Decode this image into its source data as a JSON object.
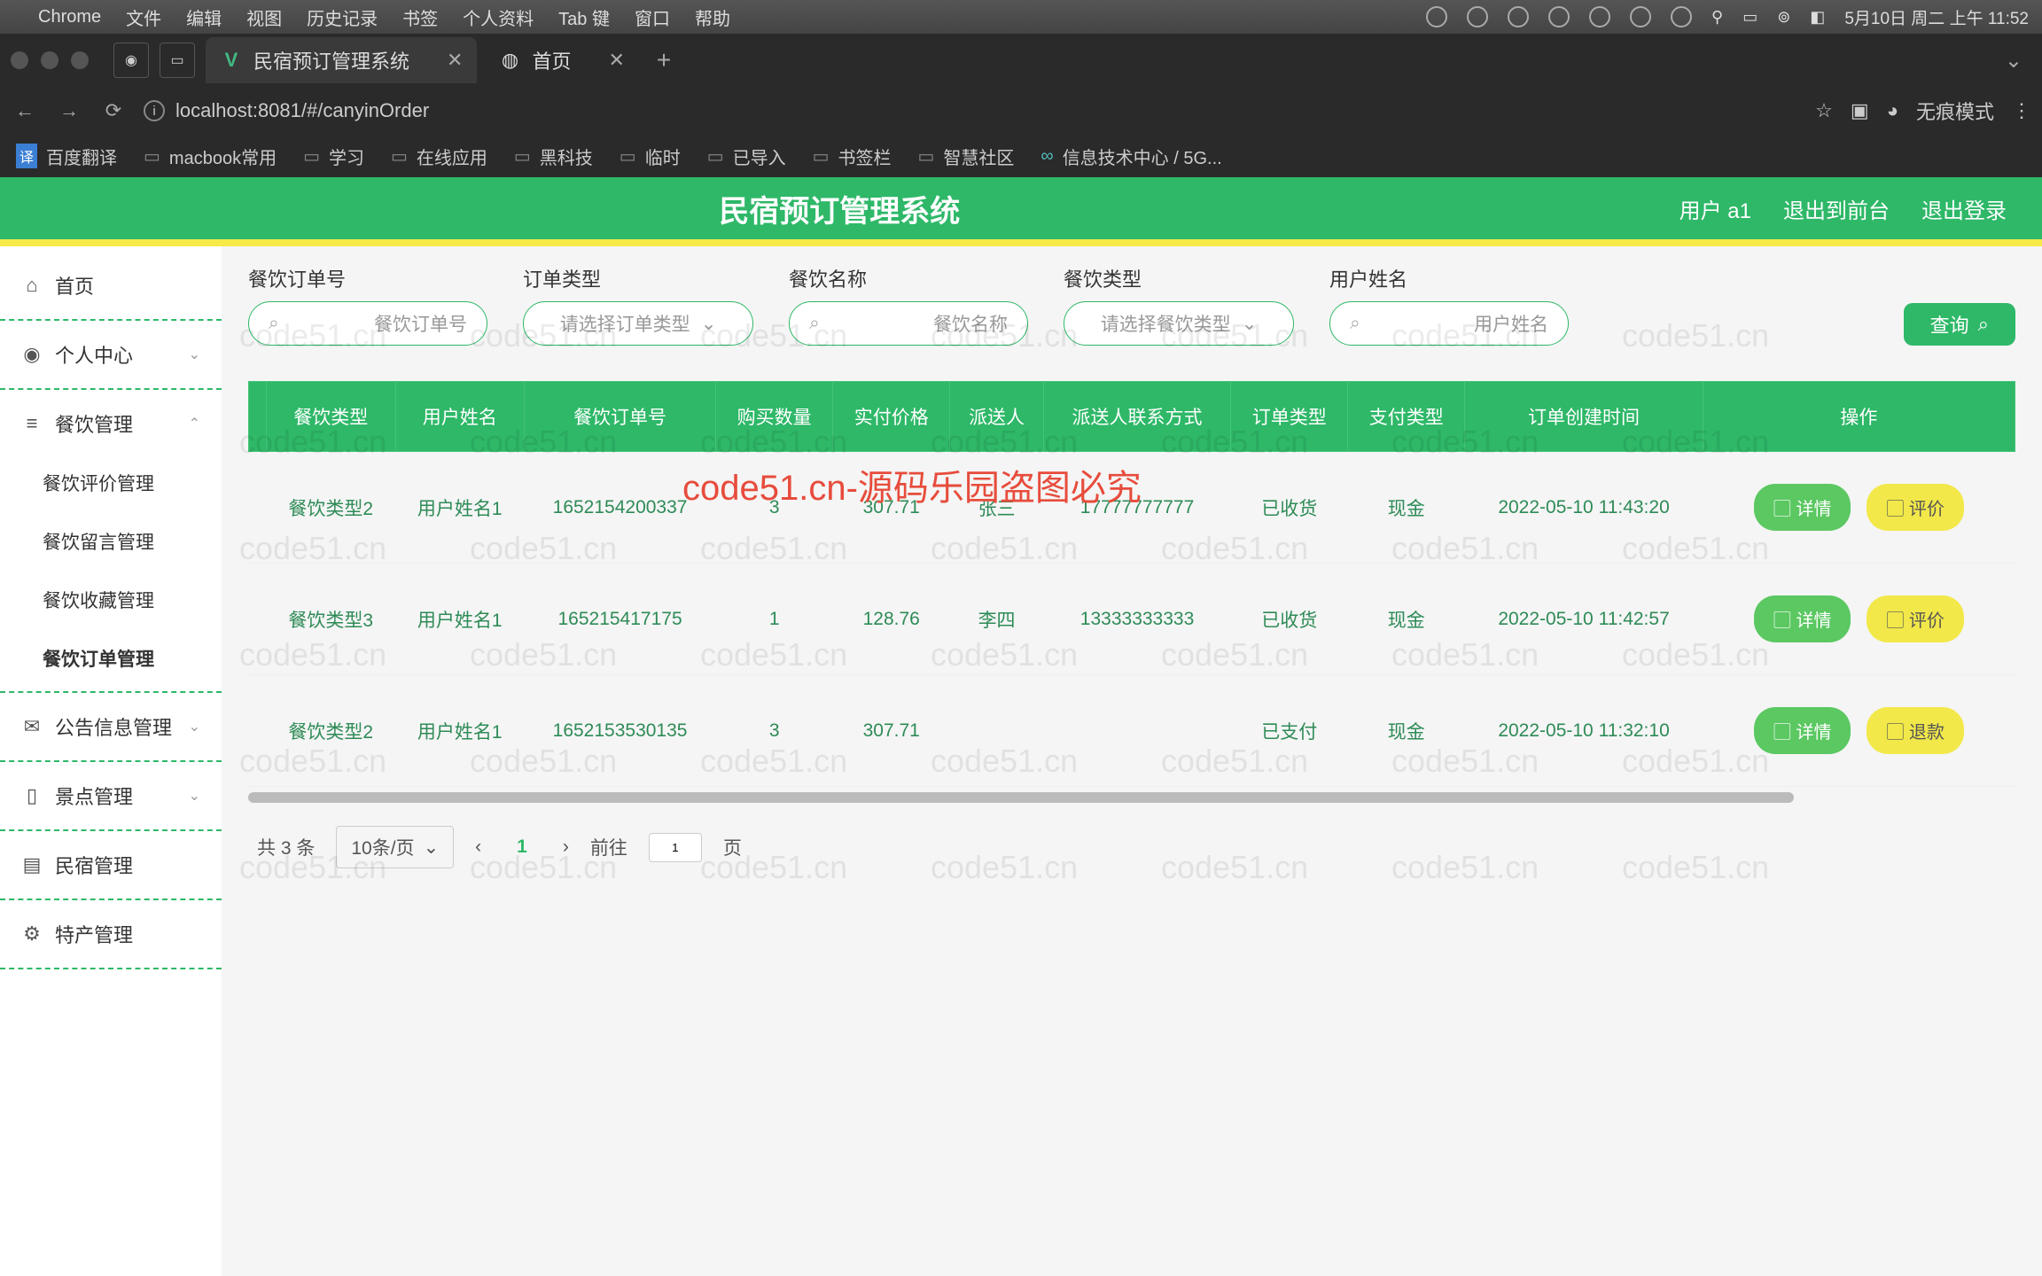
{
  "mac_menu": {
    "app": "Chrome",
    "items": [
      "文件",
      "编辑",
      "视图",
      "历史记录",
      "书签",
      "个人资料",
      "Tab 键",
      "窗口",
      "帮助"
    ],
    "clock": "5月10日 周二 上午 11:52"
  },
  "browser": {
    "tabs": [
      {
        "title": "民宿预订管理系统",
        "active": true
      },
      {
        "title": "首页",
        "active": false
      }
    ],
    "url": "localhost:8081/#/canyinOrder",
    "incognito": "无痕模式",
    "bookmarks": [
      "百度翻译",
      "macbook常用",
      "学习",
      "在线应用",
      "黑科技",
      "临时",
      "已导入",
      "书签栏",
      "智慧社区",
      "信息技术中心 / 5G..."
    ]
  },
  "app": {
    "title": "民宿预订管理系统",
    "user": "用户 a1",
    "to_front": "退出到前台",
    "logout": "退出登录"
  },
  "sidebar": {
    "home": "首页",
    "personal": "个人中心",
    "catering": "餐饮管理",
    "catering_children": [
      "餐饮评价管理",
      "餐饮留言管理",
      "餐饮收藏管理",
      "餐饮订单管理"
    ],
    "active_child": "餐饮订单管理",
    "announce": "公告信息管理",
    "spot": "景点管理",
    "homestay": "民宿管理",
    "specialty": "特产管理"
  },
  "filters": {
    "f1_label": "餐饮订单号",
    "f1_ph": "餐饮订单号",
    "f2_label": "订单类型",
    "f2_ph": "请选择订单类型",
    "f3_label": "餐饮名称",
    "f3_ph": "餐饮名称",
    "f4_label": "餐饮类型",
    "f4_ph": "请选择餐饮类型",
    "f5_label": "用户姓名",
    "f5_ph": "用户姓名",
    "query": "查询"
  },
  "table": {
    "headers": [
      "餐饮类型",
      "用户姓名",
      "餐饮订单号",
      "购买数量",
      "实付价格",
      "派送人",
      "派送人联系方式",
      "订单类型",
      "支付类型",
      "订单创建时间",
      "操作"
    ],
    "rows": [
      {
        "type": "餐饮类型2",
        "user": "用户姓名1",
        "order": "1652154200337",
        "qty": "3",
        "price": "307.71",
        "courier": "张三",
        "phone": "17777777777",
        "status": "已收货",
        "pay": "现金",
        "time": "2022-05-10 11:43:20",
        "ops": [
          "详情",
          "评价"
        ]
      },
      {
        "type": "餐饮类型3",
        "user": "用户姓名1",
        "order": "165215417175",
        "qty": "1",
        "price": "128.76",
        "courier": "李四",
        "phone": "13333333333",
        "status": "已收货",
        "pay": "现金",
        "time": "2022-05-10 11:42:57",
        "ops": [
          "详情",
          "评价"
        ]
      },
      {
        "type": "餐饮类型2",
        "user": "用户姓名1",
        "order": "1652153530135",
        "qty": "3",
        "price": "307.71",
        "courier": "",
        "phone": "",
        "status": "已支付",
        "pay": "现金",
        "time": "2022-05-10 11:32:10",
        "ops": [
          "详情",
          "退款"
        ]
      }
    ],
    "btn_detail": "详情"
  },
  "pager": {
    "total": "共 3 条",
    "size": "10条/页",
    "current": "1",
    "goto_pre": "前往",
    "goto_val": "1",
    "goto_post": "页"
  },
  "watermark": {
    "text": "code51.cn",
    "red": "code51.cn-源码乐园盗图必究"
  }
}
